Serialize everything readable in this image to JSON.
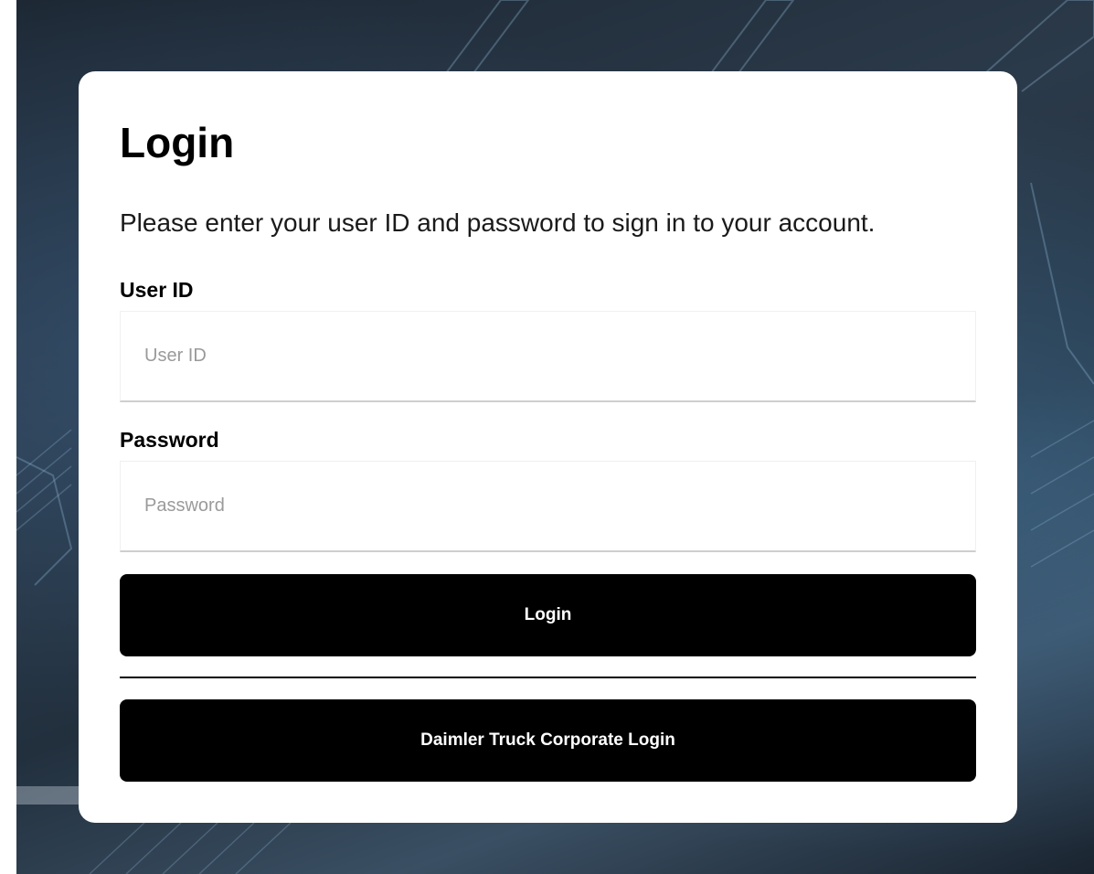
{
  "login_form": {
    "title": "Login",
    "subtitle": "Please enter your user ID and password to sign in to your account.",
    "user_id": {
      "label": "User ID",
      "placeholder": "User ID",
      "value": ""
    },
    "password": {
      "label": "Password",
      "placeholder": "Password",
      "value": ""
    },
    "login_button_label": "Login",
    "corporate_login_button_label": "Daimler Truck Corporate Login"
  },
  "colors": {
    "button_background": "#000000",
    "button_text": "#ffffff",
    "card_background": "#ffffff",
    "placeholder_text": "#9a9a9a"
  }
}
